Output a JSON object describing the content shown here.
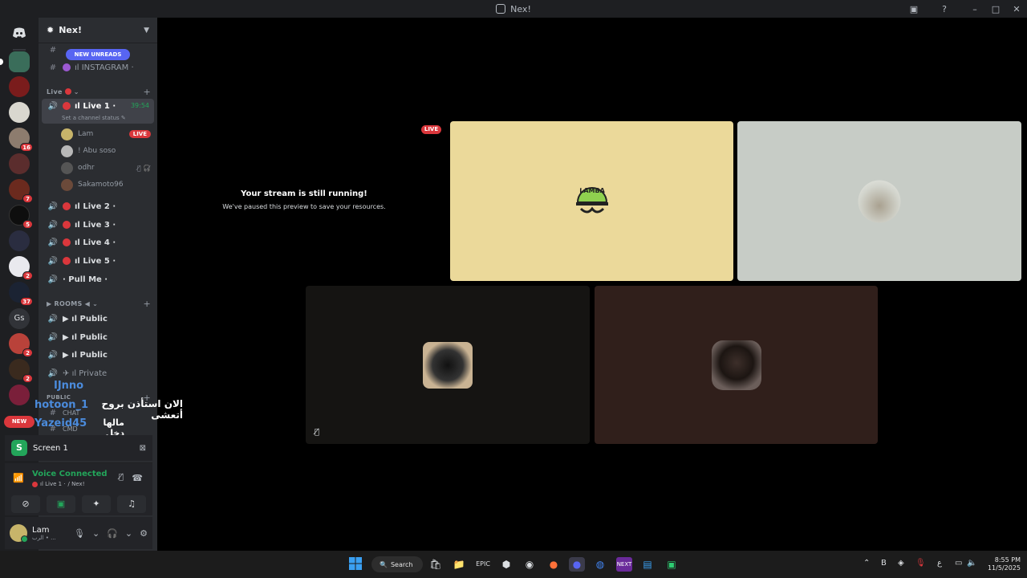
{
  "window": {
    "title": "Nex!"
  },
  "server_rail": {
    "badges": [
      "16",
      "7",
      "5",
      "2",
      "37",
      "2",
      "2"
    ],
    "gs_label": "Gs",
    "new_label": "NEW"
  },
  "sidebar": {
    "guild_name": "Nex!",
    "new_unreads": "NEW UNREADS",
    "channels_top": [
      {
        "label": "ıl INSTAGRAM ·"
      }
    ],
    "live_category": "Live",
    "live1": {
      "label": "ıl Live 1 ·",
      "time": "39:54",
      "status": "Set a channel status"
    },
    "voice_users": [
      {
        "name": "Lam",
        "tag": "LIVE"
      },
      {
        "name": "! Abu soso"
      },
      {
        "name": "odhr"
      },
      {
        "name": "Sakamoto96"
      }
    ],
    "live_channels": [
      "ıl Live 2 ·",
      "ıl Live 3 ·",
      "ıl Live 4 ·",
      "ıl Live 5 ·",
      "· Pull Me ·"
    ],
    "rooms_category": "ROOMS ◀",
    "rooms": [
      "ıl Public",
      "ıl Public",
      "ıl Public",
      "ıl Private"
    ],
    "public_category": "PUBLIC",
    "text_channels": [
      "CHAT",
      "CMD"
    ]
  },
  "overlay_chat": {
    "user1": "IJnno",
    "user2": "hotoon_1",
    "user3": "Yazeid45",
    "msg1": "الان استأذن بروح أتعشى",
    "msg2": "مالها دخل والله"
  },
  "panels": {
    "screen_label": "Screen 1",
    "voice_title": "Voice Connected",
    "voice_channel": "ıl Live 1 ·",
    "voice_server": "/ Nex!",
    "user_name": "Lam",
    "user_status": "الرب • ..."
  },
  "stage": {
    "live_tag": "LIVE",
    "paused_title": "Your stream is still running!",
    "paused_sub": "We've paused this preview to save your resources."
  },
  "taskbar": {
    "search": "Search",
    "time": "8:55 PM",
    "date": "11/5/2025",
    "lang": "ع"
  },
  "colors": {
    "accent": "#5865f2",
    "live_red": "#da373c",
    "online_green": "#23a55a",
    "tile_yellow": "#ebd99a",
    "tile_grey": "#c7ccc6",
    "tile_dark": "#151412",
    "tile_brown": "#301f1b"
  }
}
